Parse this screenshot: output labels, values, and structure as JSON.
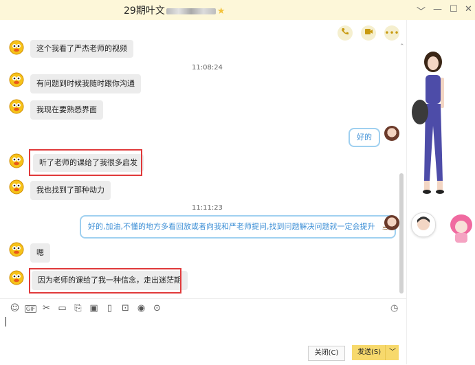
{
  "window": {
    "title": "29期叶文",
    "controls": [
      "﹀",
      "—",
      "☐",
      "✕"
    ]
  },
  "toolbar_top": {
    "phone_icon": "phone-icon",
    "video_icon": "video-icon",
    "more_icon": "more-icon"
  },
  "messages": [
    {
      "side": "left",
      "text": "这个我看了严杰老师的视频"
    },
    {
      "side": "time",
      "text": "11:08:24"
    },
    {
      "side": "left",
      "text": "有问题到时候我随时跟你沟通"
    },
    {
      "side": "left",
      "text": "我现在要熟悉界面"
    },
    {
      "side": "right",
      "text": "好的"
    },
    {
      "side": "left",
      "text": "听了老师的课给了我很多启发",
      "highlighted": true
    },
    {
      "side": "left",
      "text": "我也找到了那种动力"
    },
    {
      "side": "time",
      "text": "11:11:23"
    },
    {
      "side": "right",
      "text": "好的,加油,不懂的地方多看回放或者向我和严老师提问,找到问题解决问题就一定会提升"
    },
    {
      "side": "left",
      "text": "嗯"
    },
    {
      "side": "left",
      "text": "因为老师的课给了我一种信念，走出迷茫期",
      "highlighted": true
    }
  ],
  "input_toolbar": {
    "icons": [
      "emoji-icon",
      "gif-icon",
      "scissors-icon",
      "folder-icon",
      "doc-icon",
      "image-icon",
      "shake-icon",
      "red-packet-icon",
      "music-icon",
      "more-icon",
      "history-clock-icon"
    ],
    "gif_label": "GIF"
  },
  "buttons": {
    "close": "关闭(C)",
    "send": "发送(S)",
    "send_dropdown": "﹀"
  },
  "colors": {
    "title_bg": "#fdf7d9",
    "bubble_in": "#ececec",
    "bubble_out_border": "#9fd0f0",
    "bubble_out_text": "#3d8fd6",
    "highlight": "#e0393a",
    "send_button": "#f7d96c"
  }
}
